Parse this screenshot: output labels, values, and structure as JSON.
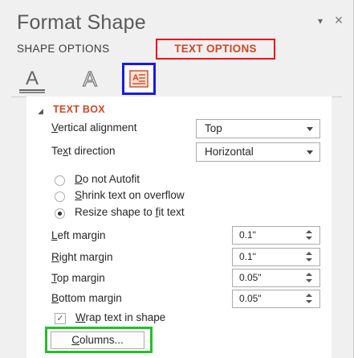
{
  "pane": {
    "title": "Format Shape",
    "pin_glyph": "▾",
    "close_glyph": "×",
    "tabs": [
      {
        "label": "SHAPE OPTIONS",
        "selected": false
      },
      {
        "label": "TEXT OPTIONS",
        "selected": true,
        "highlight_color": "#e8141b"
      }
    ],
    "icons": [
      {
        "name": "text-fill-outline-icon",
        "glyph": "A"
      },
      {
        "name": "text-effects-icon",
        "glyph": "A"
      },
      {
        "name": "textbox-icon",
        "selected": true,
        "highlight_color": "#1a1ae6"
      }
    ]
  },
  "section": {
    "caret": "◢",
    "title": "TEXT BOX"
  },
  "fields": {
    "vertical_alignment": {
      "label_underlined": "V",
      "label_rest": "ertical alignment",
      "value": "Top"
    },
    "text_direction": {
      "label_pre": "Te",
      "label_underlined": "x",
      "label_rest": "t direction",
      "value": "Horizontal"
    }
  },
  "autofit": [
    {
      "underlined": "D",
      "rest": "o not Autofit",
      "checked": false
    },
    {
      "underlined": "S",
      "rest": "hrink text on overflow",
      "checked": false
    },
    {
      "pre": "Resize shape to ",
      "underlined": "f",
      "rest": "it text",
      "checked": true
    }
  ],
  "margins": [
    {
      "underlined": "L",
      "rest": "eft margin",
      "value": "0.1\""
    },
    {
      "underlined": "R",
      "rest": "ight margin",
      "value": "0.1\""
    },
    {
      "underlined": "T",
      "rest": "op margin",
      "value": "0.05\""
    },
    {
      "underlined": "B",
      "rest": "ottom margin",
      "value": "0.05\""
    }
  ],
  "wrap": {
    "checked": true,
    "check_glyph": "✓",
    "underlined": "W",
    "rest": "rap text in shape"
  },
  "columns_button": {
    "underlined": "C",
    "rest": "olumns...",
    "highlight_color": "#22c02a"
  }
}
